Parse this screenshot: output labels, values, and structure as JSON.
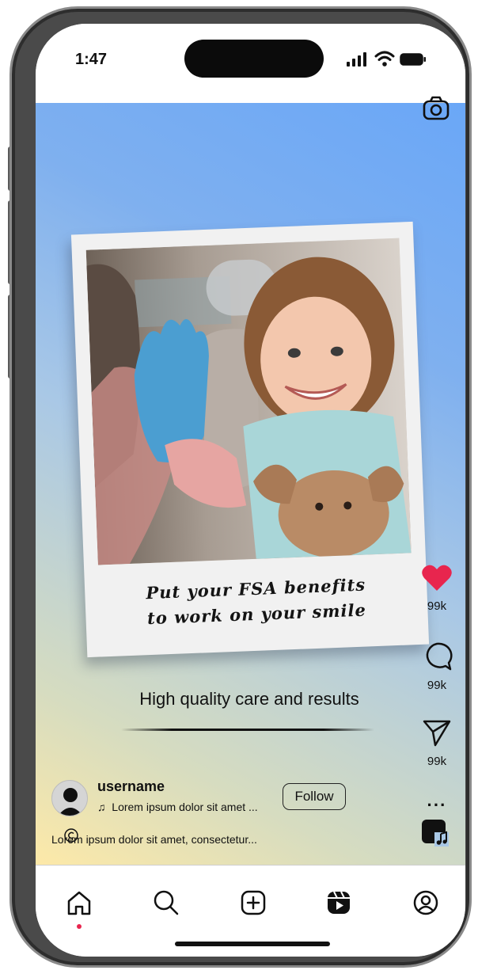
{
  "status_bar": {
    "time": "1:47"
  },
  "post": {
    "caption_line1": "Put your FSA benefits",
    "caption_line2": "to work on your smile",
    "tagline": "High quality care and results",
    "username": "username",
    "music": "Lorem ipsum dolor sit amet ...",
    "follow_label": "Follow",
    "description": "Lorem ipsum dolor sit amet, consectetur..."
  },
  "actions": {
    "likes": "99k",
    "comments": "99k",
    "shares": "99k",
    "more": "···"
  },
  "colors": {
    "like": "#e8254e",
    "gradient_top": "#6aa7f7",
    "gradient_bottom": "#fde9a8"
  },
  "nav": {
    "items": [
      "home-icon",
      "search-icon",
      "create-icon",
      "reels-icon",
      "profile-icon"
    ],
    "active": "home-icon"
  }
}
